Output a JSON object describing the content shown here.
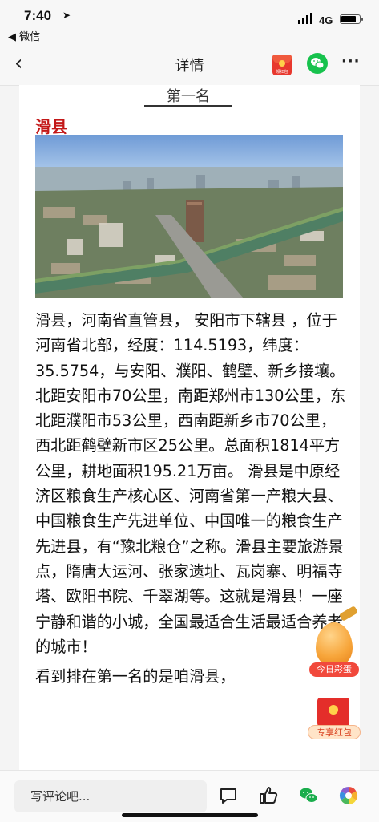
{
  "status_bar": {
    "time": "7:40",
    "location_arrow": "➤",
    "back_to_app": "◀ 微信",
    "network": "4G",
    "battery_level": 0.85
  },
  "nav": {
    "back_symbol": "‹",
    "title": "详情",
    "hongbao_icon_label": "领红包",
    "more_symbol": "···"
  },
  "article": {
    "rank_heading": "第一名",
    "county_name": "滑县",
    "paragraph_1": "滑县，河南省直管县， 安阳市下辖县 ，位于河南省北部，经度：114.5193，纬度：35.5754，与安阳、濮阳、鹤壁、新乡接壤。北距安阳市70公里，南距郑州市130公里，东北距濮阳市53公里，西南距新乡市70公里，西北距鹤壁新市区25公里。总面积1814平方公里，耕地面积195.21万亩。  滑县是中原经济区粮食生产核心区、河南省第一产粮大县、中国粮食生产先进单位、中国唯一的粮食生产先进县，有“豫北粮仓”之称。滑县主要旅游景点，隋唐大运河、张家遗址、瓦岗寨、明福寺塔、欧阳书院、千翠湖等。这就是滑县！一座宁静和谐的小城，全国最适合生活最适合养老的城市！",
    "paragraph_2": "看到排在第一名的是咱滑县，"
  },
  "floating": {
    "egg_label": "今日彩蛋",
    "packet_label": "专享红包"
  },
  "bottom_bar": {
    "comment_placeholder": "写评论吧..."
  },
  "colors": {
    "county_name": "#c31818",
    "wechat_green": "#17c24d",
    "red_packet": "#e42e2a"
  }
}
